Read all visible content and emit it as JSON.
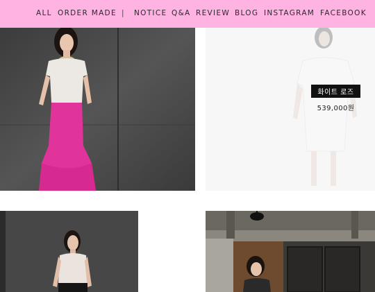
{
  "nav": {
    "items": [
      {
        "label": "ALL"
      },
      {
        "label": "ORDER MADE"
      },
      {
        "label": "|"
      },
      {
        "label": "NOTICE"
      },
      {
        "label": "Q&A"
      },
      {
        "label": "REVIEW"
      },
      {
        "label": "BLOG"
      },
      {
        "label": "INSTAGRAM"
      },
      {
        "label": "FACEBOOK"
      }
    ],
    "background": "#ffb3e3"
  },
  "products": [
    {
      "image": "model-white-lace-top-pink-mermaid-skirt"
    },
    {
      "image": "model-white-puff-sleeve-dress",
      "name": "화이트 로즈",
      "price": "539,000원",
      "hovered": true
    },
    {
      "image": "model-white-sleeveless-top-black-skirt"
    },
    {
      "image": "model-in-kitchen-interior"
    }
  ]
}
